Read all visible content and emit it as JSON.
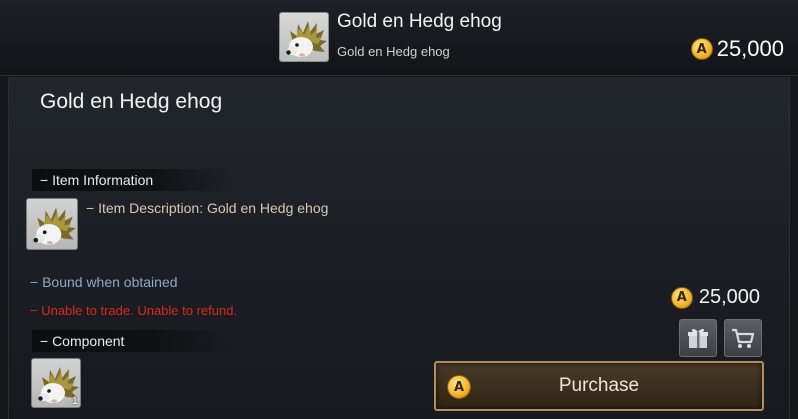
{
  "header": {
    "title": "Gold en Hedg ehog",
    "subtitle": "Gold en Hedg ehog",
    "price": "25,000",
    "currency_icon": "coin-a-icon",
    "item_icon": "hedgehog-icon"
  },
  "item": {
    "name": "Gold en Hedg ehog",
    "item_info_header": "− Item Information",
    "description": "− Item Description: Gold en Hedg ehog",
    "bound": "− Bound when obtained",
    "trade_notice": "− Unable to trade. Unable to refund.",
    "component_header": "− Component",
    "component_count": "1"
  },
  "purchase": {
    "price": "25,000",
    "gift_icon": "gift-icon",
    "cart_icon": "cart-icon",
    "button_label": "Purchase"
  },
  "colors": {
    "gold_coin": "#f0b12a",
    "bound_text": "#8fa7c8",
    "warning_text": "#d62a1f",
    "purchase_border": "#b38d5a"
  }
}
